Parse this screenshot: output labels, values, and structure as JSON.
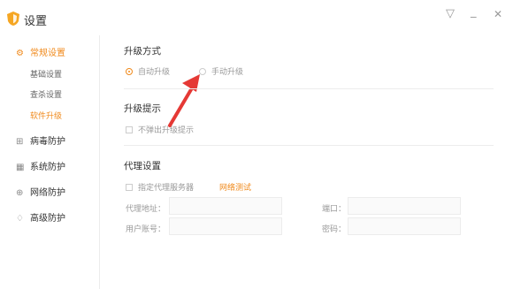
{
  "window": {
    "title": "设置",
    "controls": {
      "menu_icon": "▽",
      "minimize_icon": "_",
      "close_icon": "✕"
    }
  },
  "sidebar": {
    "items": [
      {
        "label": "常规设置",
        "icon": "gear-icon",
        "glyph": "⚙",
        "active": true
      },
      {
        "label": "病毒防护",
        "icon": "plus-square-icon",
        "glyph": "⊞",
        "active": false
      },
      {
        "label": "系统防护",
        "icon": "grid-icon",
        "glyph": "▦",
        "active": false
      },
      {
        "label": "网络防护",
        "icon": "globe-icon",
        "glyph": "⊕",
        "active": false
      },
      {
        "label": "高级防护",
        "icon": "shield-icon",
        "glyph": "♢",
        "active": false
      }
    ],
    "sub_items": [
      {
        "label": "基础设置",
        "active": false
      },
      {
        "label": "查杀设置",
        "active": false
      },
      {
        "label": "软件升级",
        "active": true
      }
    ]
  },
  "main": {
    "upgrade_mode": {
      "title": "升级方式",
      "options": [
        {
          "label": "自动升级",
          "selected": true
        },
        {
          "label": "手动升级",
          "selected": false
        }
      ]
    },
    "upgrade_prompt": {
      "title": "升级提示",
      "checkbox_label": "不弹出升级提示",
      "checked": false
    },
    "proxy": {
      "title": "代理设置",
      "checkbox_label": "指定代理服务器",
      "checked": false,
      "test_link": "网络测试",
      "address_label": "代理地址：",
      "port_label": "端口：",
      "user_label": "用户账号：",
      "password_label": "密码："
    }
  },
  "colors": {
    "accent": "#f08a1c",
    "arrow": "#e53935"
  }
}
